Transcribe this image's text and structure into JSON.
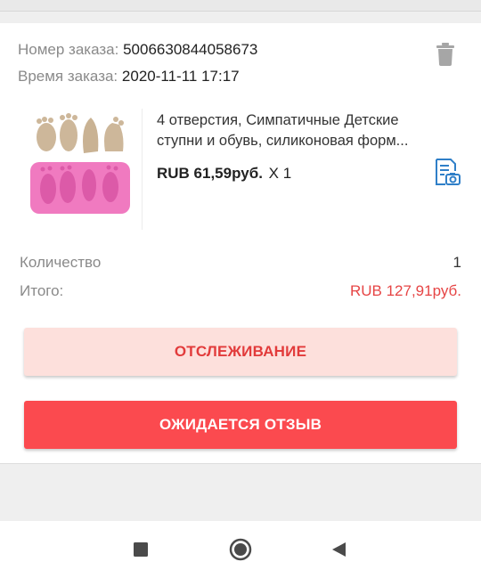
{
  "order": {
    "number_label": "Номер заказа:",
    "number_value": "5006630844058673",
    "time_label": "Время заказа:",
    "time_value": "2020-11-11 17:17"
  },
  "product": {
    "title_line1": "4 отверстия, Симпатичные Детские",
    "title_line2": "ступни и обувь, силиконовая форм...",
    "price": "RUB 61,59руб.",
    "quantity_multiplier": "X 1"
  },
  "summary": {
    "quantity_label": "Количество",
    "quantity_value": "1",
    "total_label": "Итого:",
    "total_value": "RUB 127,91руб."
  },
  "buttons": {
    "track_label": "ОТСЛЕЖИВАНИЕ",
    "review_label": "ОЖИДАЕТСЯ ОТЗЫВ"
  },
  "icons": {
    "delete": "trash-icon",
    "snapshot": "order-snapshot-icon",
    "nav_recent": "square-icon",
    "nav_home": "circle-icon",
    "nav_back": "triangle-back-icon"
  },
  "colors": {
    "accent_red": "#fb4a4f",
    "total_red": "#e64545",
    "track_bg": "#fde0dc",
    "snapshot_blue": "#2f7fc8"
  }
}
